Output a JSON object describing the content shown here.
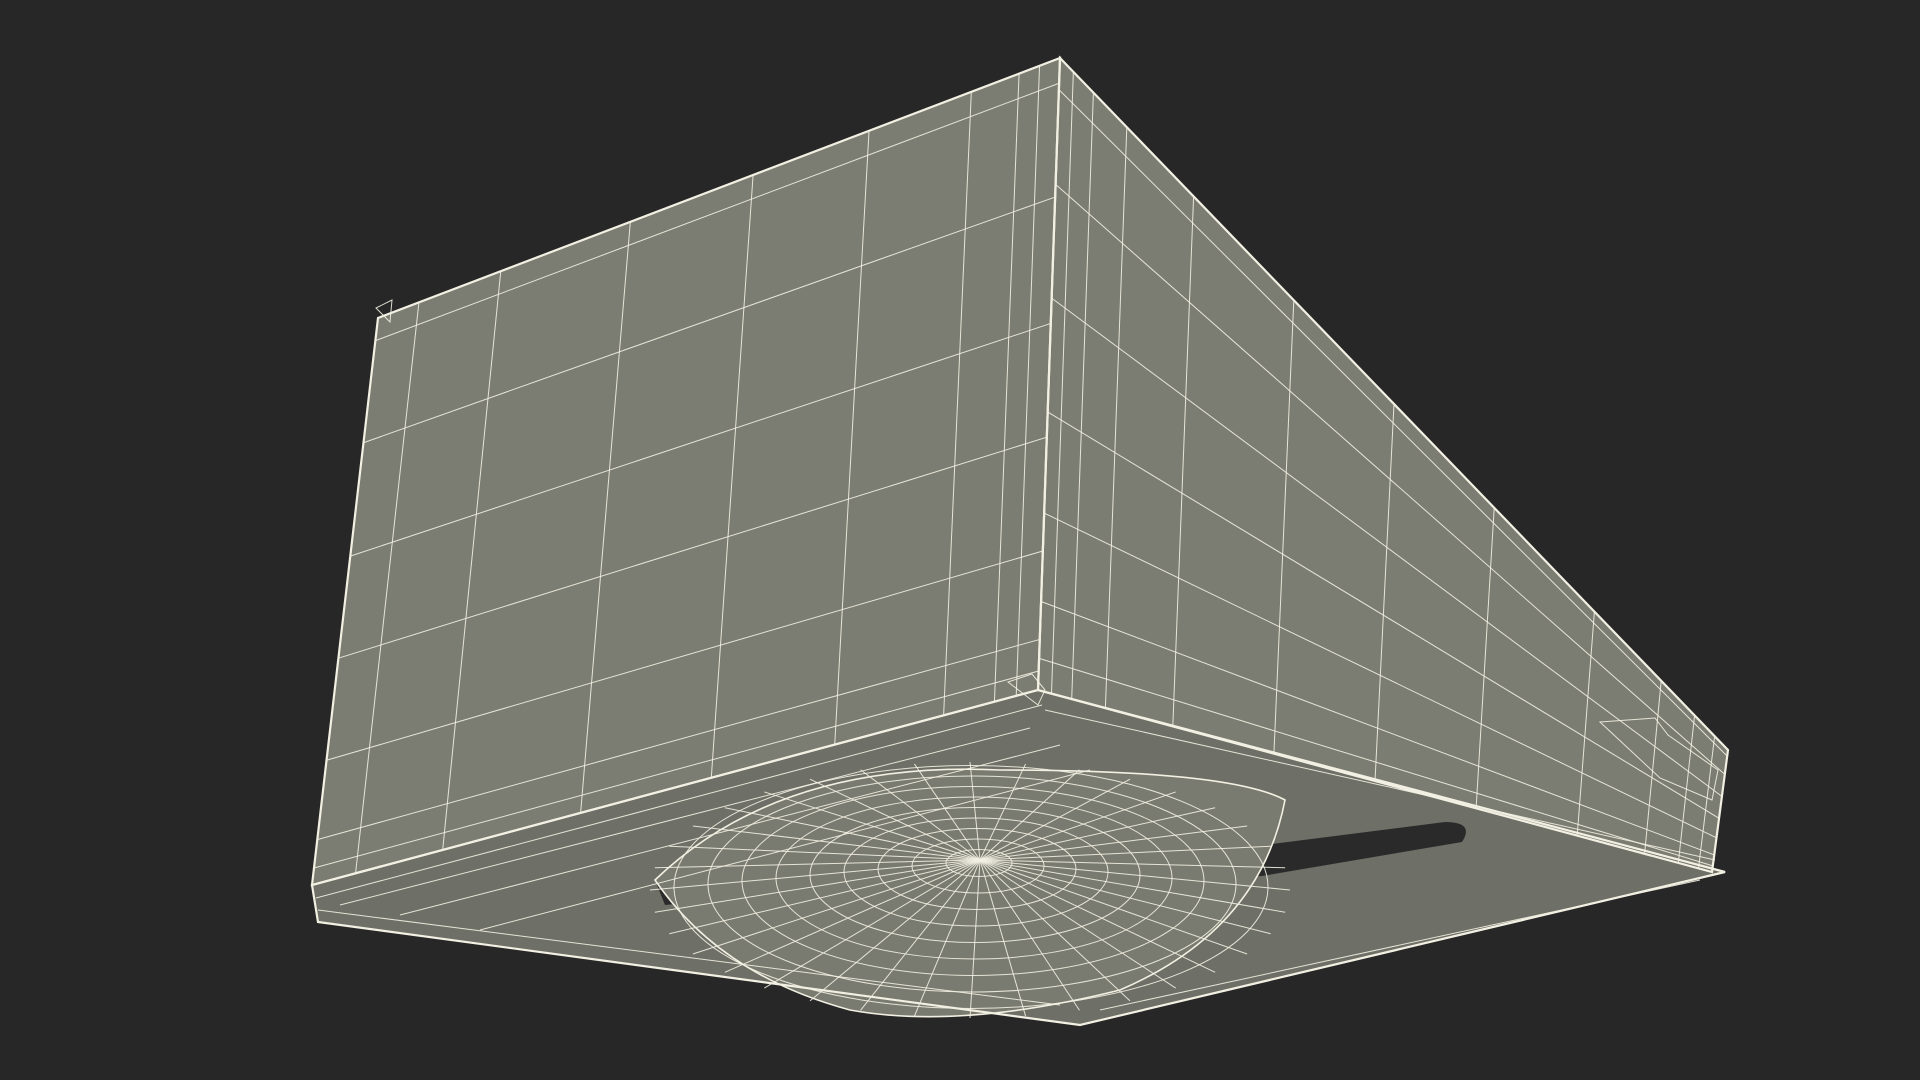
{
  "scene": {
    "background_color": "#272727",
    "surface_color": "#7c7d72",
    "surface_dark_color": "#6e6f66",
    "slot_color": "#2a2a2a",
    "wire_color": "#f2f0e2",
    "render_style": "wireframe-over-shaded",
    "subject": "3d-model-underside-wireframe"
  }
}
